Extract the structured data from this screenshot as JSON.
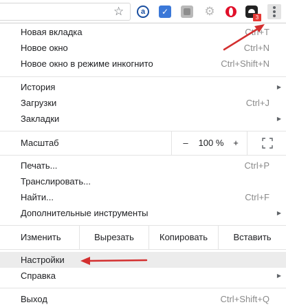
{
  "toolbar": {
    "icons": [
      "star-icon",
      "extension-a-icon",
      "extension-check-icon",
      "extension-puzzle-icon",
      "extension-gear-icon",
      "opera-icon",
      "ghostery-icon",
      "kebab-menu-icon"
    ],
    "ext_a_letter": "a",
    "ext_check_glyph": "✓",
    "badge_count": "3"
  },
  "menu": {
    "new_tab": {
      "label": "Новая вкладка",
      "shortcut": "Ctrl+T"
    },
    "new_window": {
      "label": "Новое окно",
      "shortcut": "Ctrl+N"
    },
    "incognito": {
      "label": "Новое окно в режиме инкогнито",
      "shortcut": "Ctrl+Shift+N"
    },
    "history": {
      "label": "История"
    },
    "downloads": {
      "label": "Загрузки",
      "shortcut": "Ctrl+J"
    },
    "bookmarks": {
      "label": "Закладки"
    },
    "zoom": {
      "label": "Масштаб",
      "minus": "–",
      "value": "100 %",
      "plus": "+"
    },
    "print": {
      "label": "Печать...",
      "shortcut": "Ctrl+P"
    },
    "cast": {
      "label": "Транслировать..."
    },
    "find": {
      "label": "Найти...",
      "shortcut": "Ctrl+F"
    },
    "more_tools": {
      "label": "Дополнительные инструменты"
    },
    "edit": {
      "label": "Изменить",
      "cut": "Вырезать",
      "copy": "Копировать",
      "paste": "Вставить"
    },
    "settings": {
      "label": "Настройки"
    },
    "help": {
      "label": "Справка"
    },
    "exit": {
      "label": "Выход",
      "shortcut": "Ctrl+Shift+Q"
    }
  },
  "colors": {
    "annotation_arrow": "#d32f2f",
    "highlight": "#ececec",
    "badge": "#e53935"
  }
}
